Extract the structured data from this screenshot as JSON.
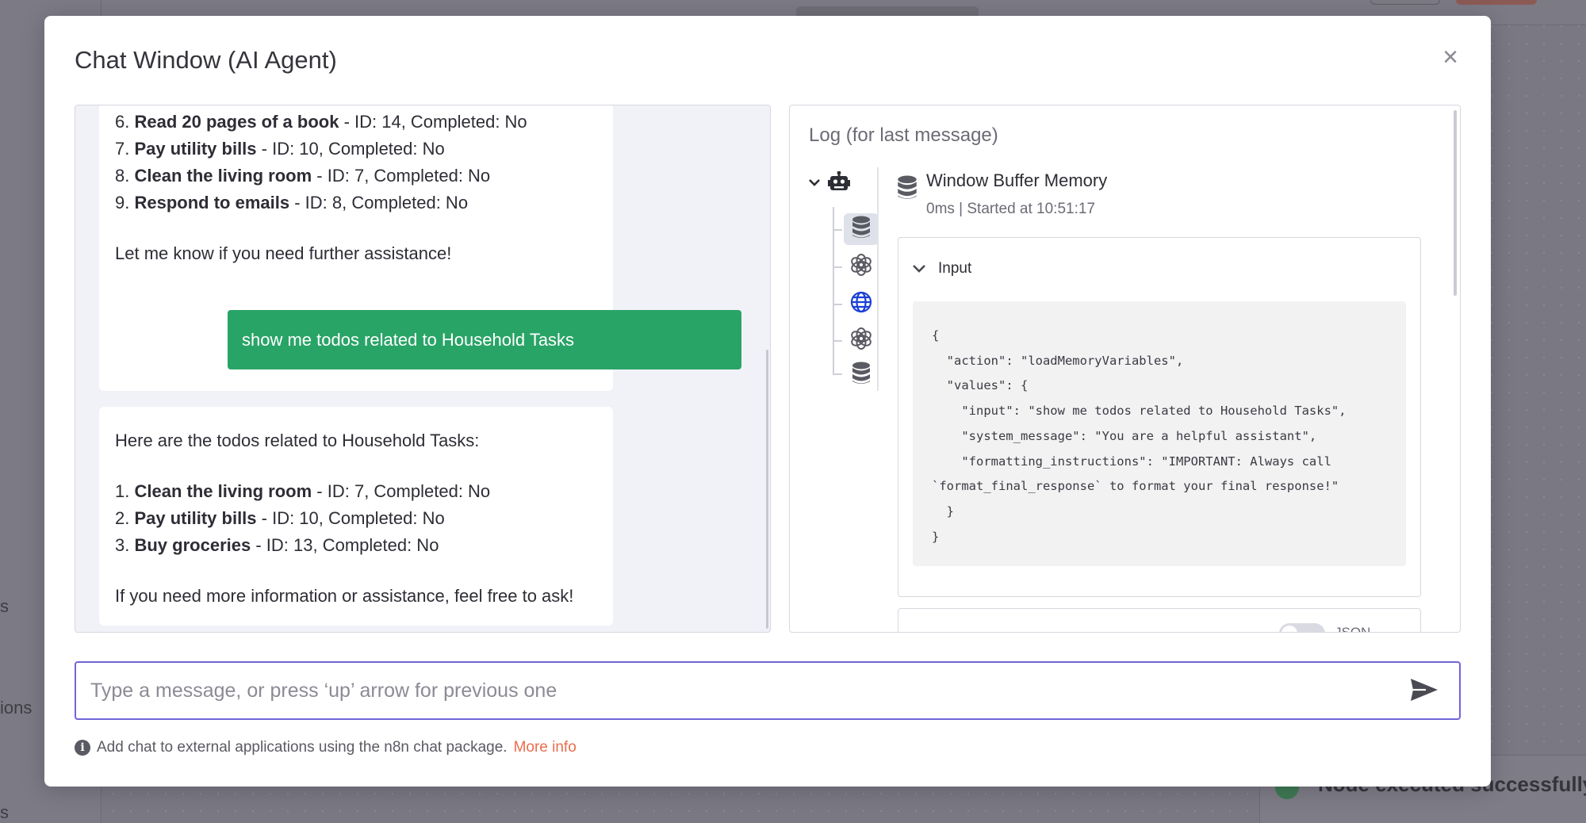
{
  "background": {
    "sidebar_fragments": [
      "s",
      "ions",
      "s"
    ],
    "toast_text": "Node executed successfully"
  },
  "modal": {
    "title": "Chat Window (AI Agent)",
    "close_glyph": "×"
  },
  "chat": {
    "messages": [
      {
        "role": "bot",
        "items": [
          {
            "num": "6.",
            "bold": "Read 20 pages of a book",
            "rest": " - ID: 14, Completed: No"
          },
          {
            "num": "7.",
            "bold": "Pay utility bills",
            "rest": " - ID: 10, Completed: No"
          },
          {
            "num": "8.",
            "bold": "Clean the living room",
            "rest": " - ID: 7, Completed: No"
          },
          {
            "num": "9.",
            "bold": "Respond to emails",
            "rest": " - ID: 8, Completed: No"
          }
        ],
        "closing": "Let me know if you need further assistance!"
      },
      {
        "role": "user",
        "text": "show me todos related to Household Tasks"
      },
      {
        "role": "bot",
        "intro": "Here are the todos related to Household Tasks:",
        "items": [
          {
            "num": "1.",
            "bold": "Clean the living room",
            "rest": " - ID: 7, Completed: No"
          },
          {
            "num": "2.",
            "bold": "Pay utility bills",
            "rest": " - ID: 10, Completed: No"
          },
          {
            "num": "3.",
            "bold": "Buy groceries",
            "rest": " - ID: 13, Completed: No"
          }
        ],
        "closing": "If you need more information or assistance, feel free to ask!"
      }
    ]
  },
  "log": {
    "title": "Log (for last message)",
    "tree": [
      "robot-icon",
      "database-icon",
      "openai-icon",
      "globe-icon",
      "openai-icon",
      "database-icon"
    ],
    "node_name": "Window Buffer Memory",
    "node_meta": "0ms | Started at 10:51:17",
    "input_label": "Input",
    "input_json": "{\n  \"action\": \"loadMemoryVariables\",\n  \"values\": {\n    \"input\": \"show me todos related to Household Tasks\",\n    \"system_message\": \"You are a helpful assistant\",\n    \"formatting_instructions\": \"IMPORTANT: Always call\n`format_final_response` to format your final response!\"\n  }\n}",
    "toggle_label": "JSON"
  },
  "input": {
    "placeholder": "Type a message, or press ‘up’ arrow for previous one"
  },
  "footer": {
    "note": "Add chat to external applications using the n8n chat package.",
    "link": "More info"
  },
  "colors": {
    "accent": "#7164d9",
    "user_bubble": "#29a467",
    "link": "#ea6d4e",
    "globe": "#1a3fd6"
  }
}
